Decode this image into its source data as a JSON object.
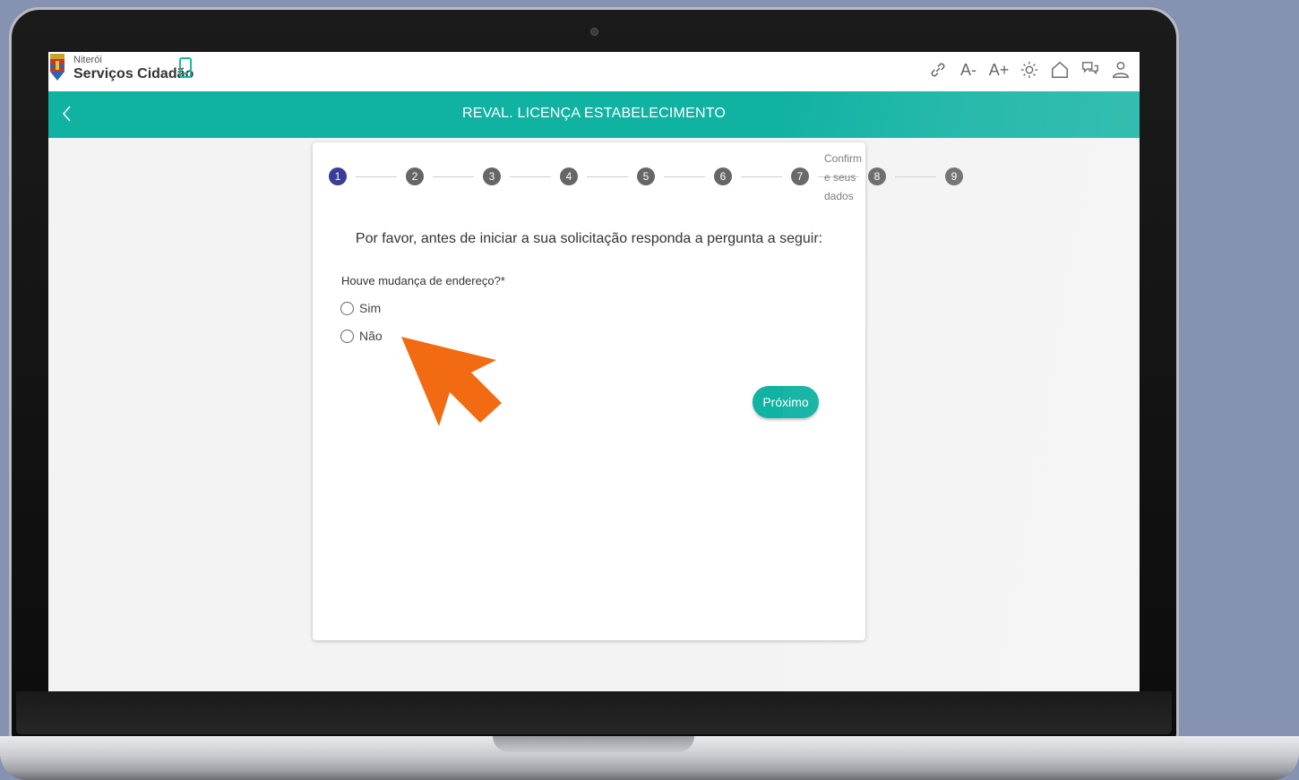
{
  "brand": {
    "city": "Niterói",
    "name": "Serviços Cidadão"
  },
  "toolbar": [
    {
      "name": "link-icon",
      "label": ""
    },
    {
      "name": "font-decrease-icon",
      "label": "A-"
    },
    {
      "name": "font-increase-icon",
      "label": "A+"
    },
    {
      "name": "contrast-icon",
      "label": ""
    },
    {
      "name": "home-icon",
      "label": ""
    },
    {
      "name": "chat-icon",
      "label": ""
    },
    {
      "name": "user-icon",
      "label": ""
    }
  ],
  "header": {
    "title": "REVAL. LICENÇA ESTABELECIMENTO"
  },
  "stepper": {
    "steps": [
      "1",
      "2",
      "3",
      "4",
      "5",
      "6",
      "7",
      "8",
      "9"
    ],
    "active_step": "1",
    "last_step_label": "Confirm e seus dados"
  },
  "form": {
    "intro": "Por favor, antes de iniciar a sua solicitação responda a pergunta a seguir:",
    "question": "Houve mudança de endereço?*",
    "options": [
      "Sim",
      "Não"
    ],
    "next_label": "Próximo"
  },
  "colors": {
    "accent": "#10b2a2",
    "active_step": "#3a3d96",
    "annotation_arrow": "#f26a12"
  }
}
